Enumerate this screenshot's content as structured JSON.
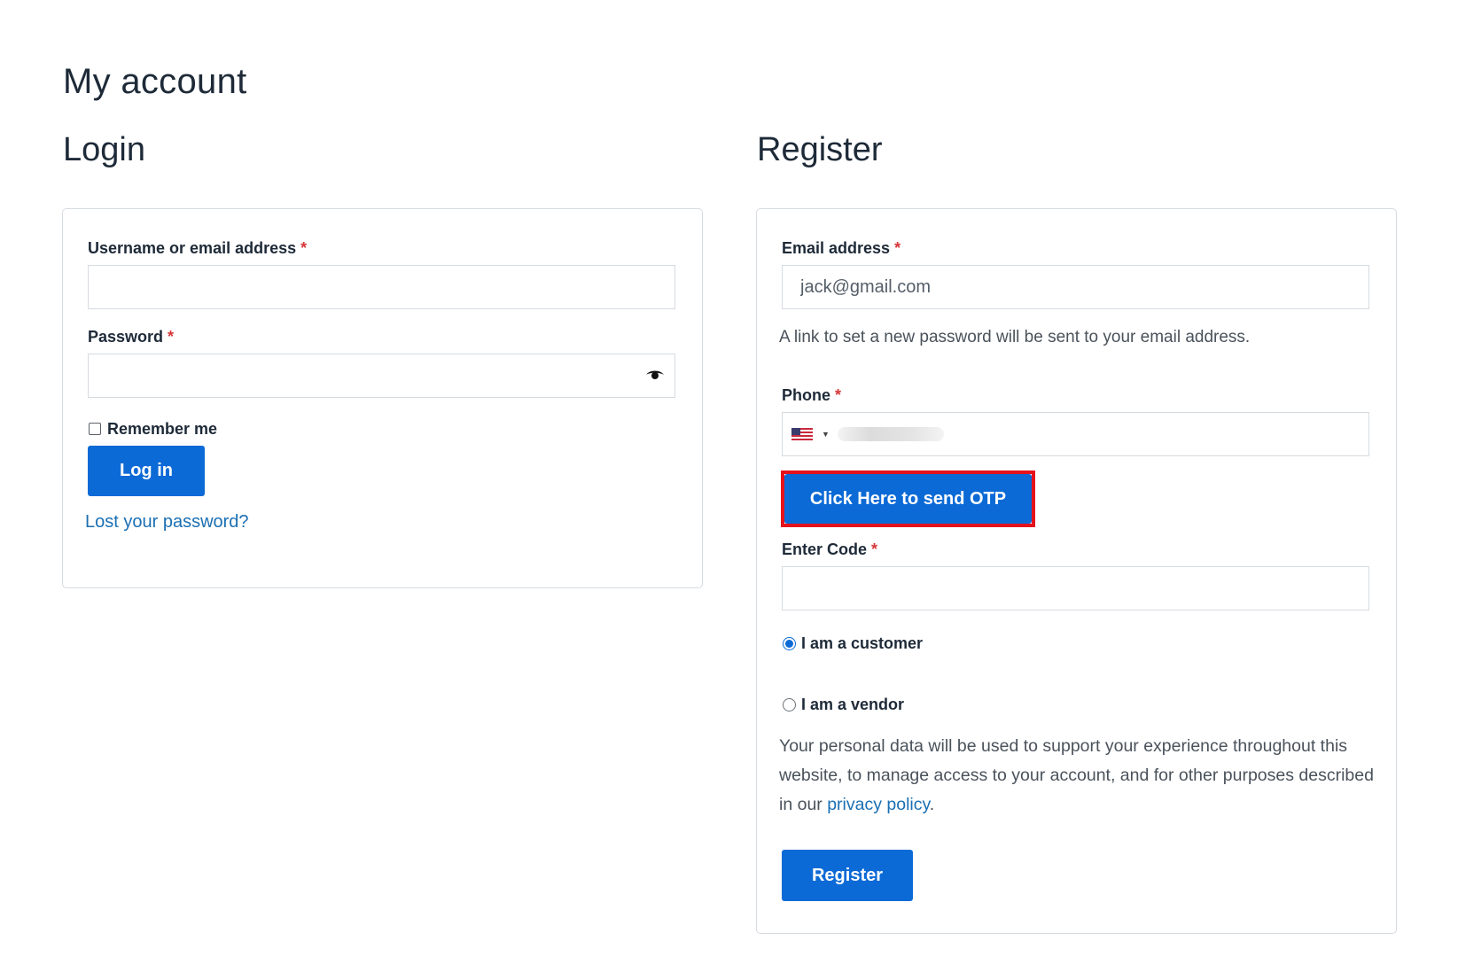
{
  "page": {
    "title": "My account"
  },
  "login": {
    "heading": "Login",
    "username_label": "Username or email address",
    "username_value": "",
    "password_label": "Password",
    "password_value": "",
    "required_mark": "*",
    "remember_label": "Remember me",
    "remember_checked": false,
    "login_button": "Log in",
    "lost_password_link": "Lost your password?"
  },
  "register": {
    "heading": "Register",
    "email_label": "Email address",
    "email_value": "jack@gmail.com",
    "email_hint": "A link to set a new password will be sent to your email address.",
    "phone_label": "Phone",
    "phone_country": "US",
    "otp_button": "Click Here to send OTP",
    "code_label": "Enter Code",
    "code_value": "",
    "role_options": [
      {
        "label": "I am a customer",
        "selected": true
      },
      {
        "label": "I am a vendor",
        "selected": false
      }
    ],
    "privacy_text_before": "Your personal data will be used to support your experience throughout this website, to manage access to your account, and for other purposes described in our ",
    "privacy_link": "privacy policy",
    "privacy_text_after": ".",
    "register_button": "Register",
    "required_mark": "*"
  },
  "colors": {
    "primary": "#0c6ad6",
    "required": "#d63638",
    "highlight": "#e4121c",
    "link": "#1a6fb3"
  }
}
